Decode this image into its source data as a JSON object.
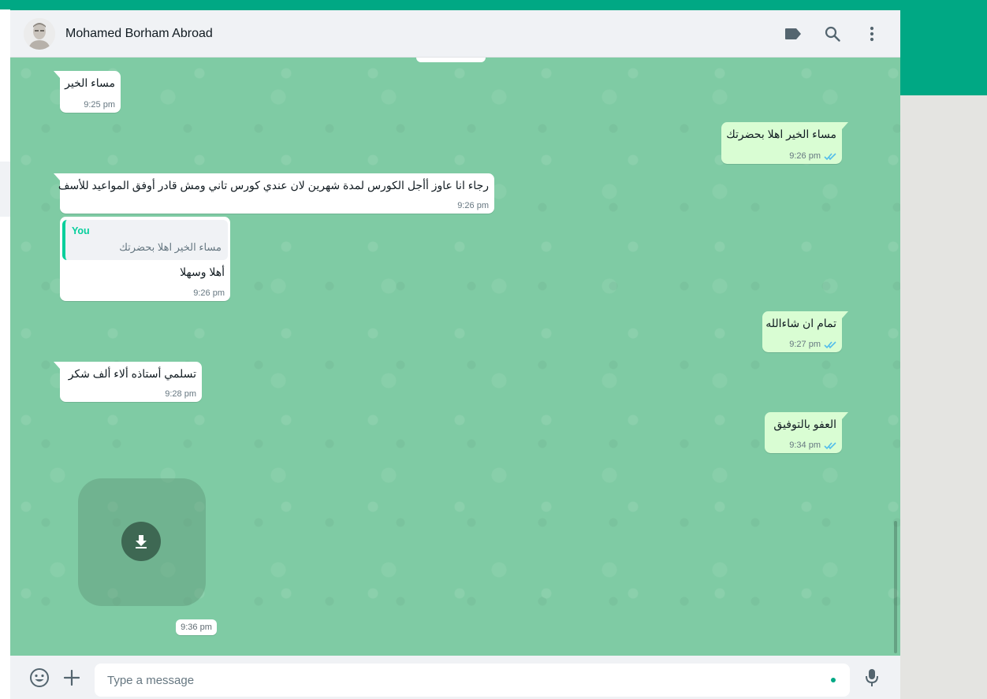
{
  "header": {
    "contact_name": "Mohamed Borham Abroad",
    "icons": [
      "label-icon",
      "search-icon",
      "menu-icon"
    ]
  },
  "messages": [
    {
      "direction": "in",
      "text": "مساء الخير",
      "time": "9:25 pm"
    },
    {
      "direction": "out",
      "text": "مساء الخير اهلا بحضرتك",
      "time": "9:26 pm",
      "status": "read"
    },
    {
      "direction": "in",
      "text": "رجاء انا عاوز أأجل الكورس لمدة شهرين لان عندي كورس تاني ومش قادر أوفق المواعيد للأسف",
      "time": "9:26 pm"
    },
    {
      "direction": "in",
      "quote_author": "You",
      "quote_text": "مساء الخير اهلا بحضرتك",
      "text": "أهلا وسهلا",
      "time": "9:26 pm"
    },
    {
      "direction": "out",
      "text": "تمام ان شاءالله",
      "time": "9:27 pm",
      "status": "read"
    },
    {
      "direction": "in",
      "text": "تسلمي أستاذه ألاء  ألف شكر",
      "time": "9:28 pm"
    },
    {
      "direction": "out",
      "text": "العفو بالتوفيق",
      "time": "9:34 pm",
      "status": "read"
    }
  ],
  "media": {
    "type": "sticker",
    "icon": "download-icon",
    "time": "9:36 pm"
  },
  "composer": {
    "placeholder": "Type a message",
    "icons": [
      "emoji-icon",
      "attach-icon",
      "mic-icon"
    ]
  },
  "colors": {
    "accent": "#00a884",
    "incoming_bubble": "#ffffff",
    "outgoing_bubble": "#d9fdd3",
    "chat_background": "#7fcba4",
    "read_ticks": "#53bdeb"
  }
}
